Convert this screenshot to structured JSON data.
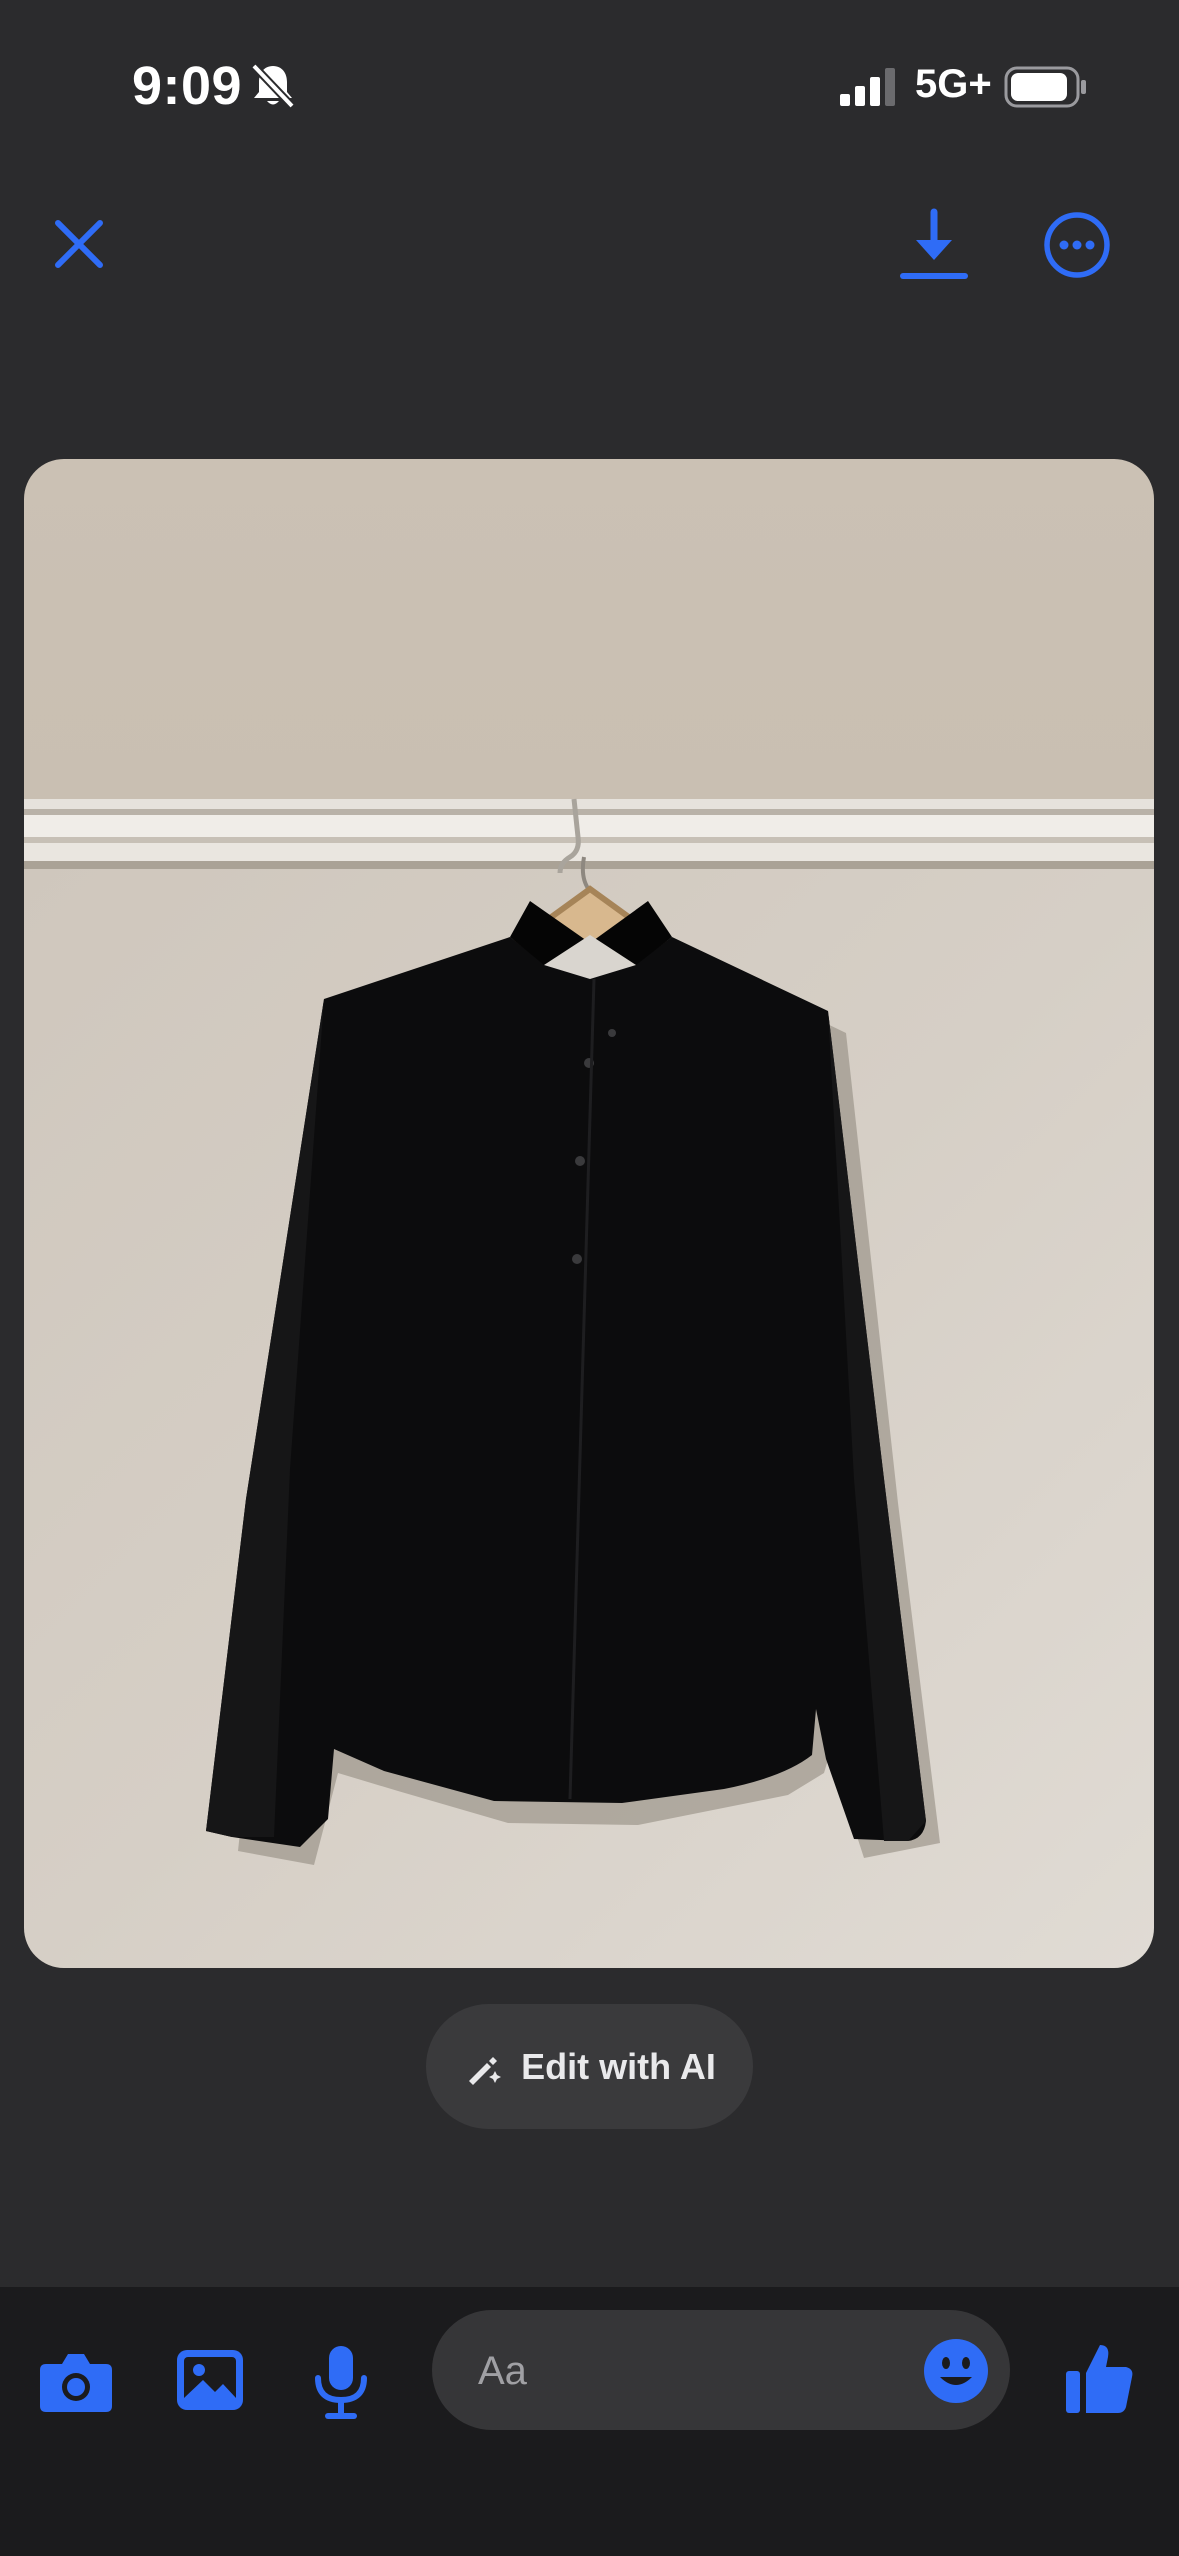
{
  "status_bar": {
    "time": "9:09",
    "network": "5G+",
    "battery_level": 0.9,
    "signal_bars": 3
  },
  "top_bar": {
    "icons": [
      "close-icon",
      "download-icon",
      "more-options-icon"
    ]
  },
  "photo": {
    "subject": "shirt-photo"
  },
  "edit_ai": {
    "label": "Edit with AI",
    "icon": "magic-pen-icon"
  },
  "composer": {
    "placeholder": "Aa",
    "value": ""
  },
  "bottom_bar": {
    "icons": [
      "camera-icon",
      "gallery-icon",
      "microphone-icon",
      "emoji-icon",
      "thumbs-up-icon"
    ]
  },
  "colors": {
    "accent": "#2f6cf6",
    "background": "#2b2b2d",
    "bottom_bar": "#1b1b1d"
  }
}
